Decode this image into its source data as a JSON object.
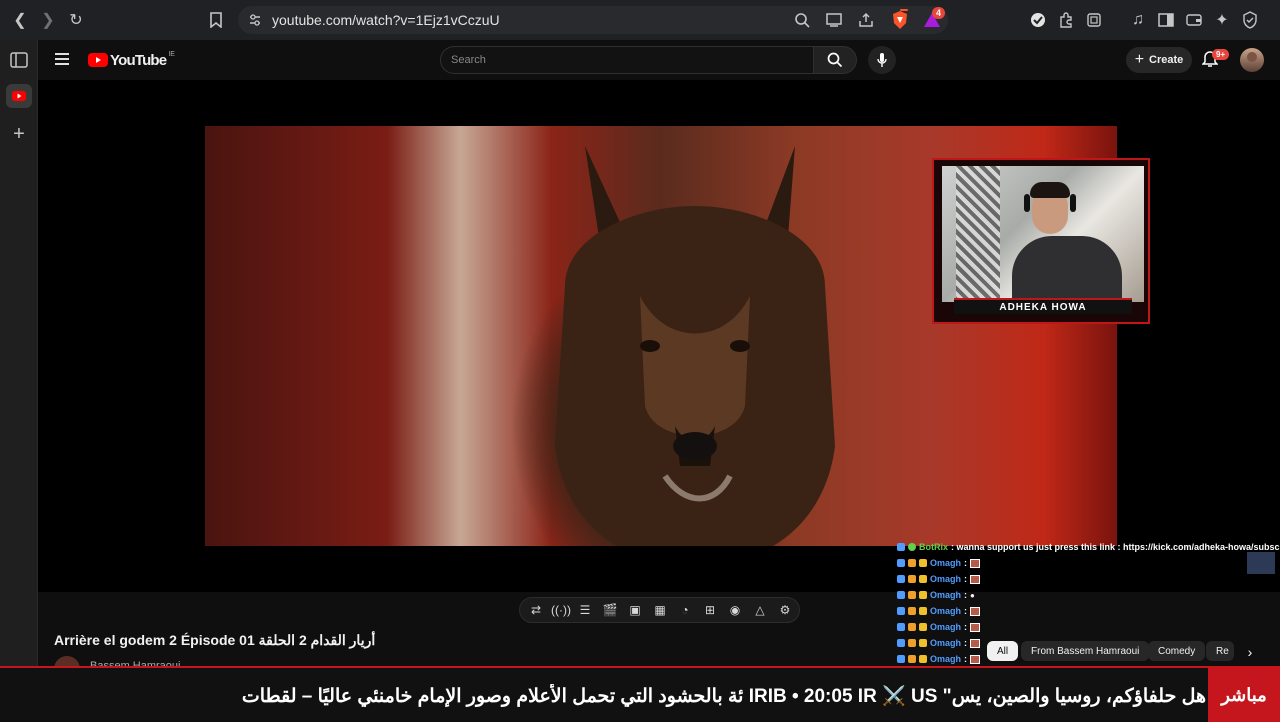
{
  "browser": {
    "url": "youtube.com/watch?v=1Ejz1vCczuU",
    "ext_badge_1": "",
    "ext_badge_2": "4",
    "icons": [
      "back-icon",
      "forward-icon",
      "reload-icon",
      "bookmark-icon",
      "site-info-icon",
      "search-icon",
      "cast-icon",
      "share-icon",
      "brave-shield-icon",
      "brave-rewards-icon",
      "extension-icon",
      "puzzle-icon",
      "music-icon",
      "sidebar-icon",
      "wallet-icon",
      "leo-icon",
      "vpn-icon"
    ]
  },
  "youtube": {
    "logo_text": "YouTube",
    "logo_region": "IE",
    "search_placeholder": "Search",
    "create_label": "Create",
    "notif_badge": "9+"
  },
  "overlay": {
    "cam_label": "ADHEKA HOWA",
    "chat": [
      {
        "user": "BotRix",
        "msg": ": wanna support us just press this link : https://kick.com/adheka-howa/subscribe",
        "bot": true
      },
      {
        "user": "Omagh",
        "msg": ":",
        "bot": false
      },
      {
        "user": "Omagh",
        "msg": ":",
        "bot": false
      },
      {
        "user": "Omagh",
        "msg": ":",
        "bot": false
      },
      {
        "user": "Omagh",
        "msg": ":",
        "bot": false
      },
      {
        "user": "Omagh",
        "msg": ":",
        "bot": false
      },
      {
        "user": "Omagh",
        "msg": ":",
        "bot": false
      },
      {
        "user": "Omagh",
        "msg": ":",
        "bot": false
      }
    ]
  },
  "video": {
    "title": "Arrière el godem 2 Épisode 01 أريار القدام 2 الحلقة",
    "channel": "Bassem Hamraoui"
  },
  "chips": [
    "All",
    "From Bassem Hamraoui",
    "Comedy",
    "Re"
  ],
  "ticker": {
    "text": "ئة بالحشود التي تحمل الأعلام وصور الإمام خامنئي عاليًا – لقطات IRIB  •  20:05  IR ⚔️ US \"هل حلفاؤكم، روسيا والصين، يس",
    "live_label": "مباشر",
    "time": "20:05"
  }
}
